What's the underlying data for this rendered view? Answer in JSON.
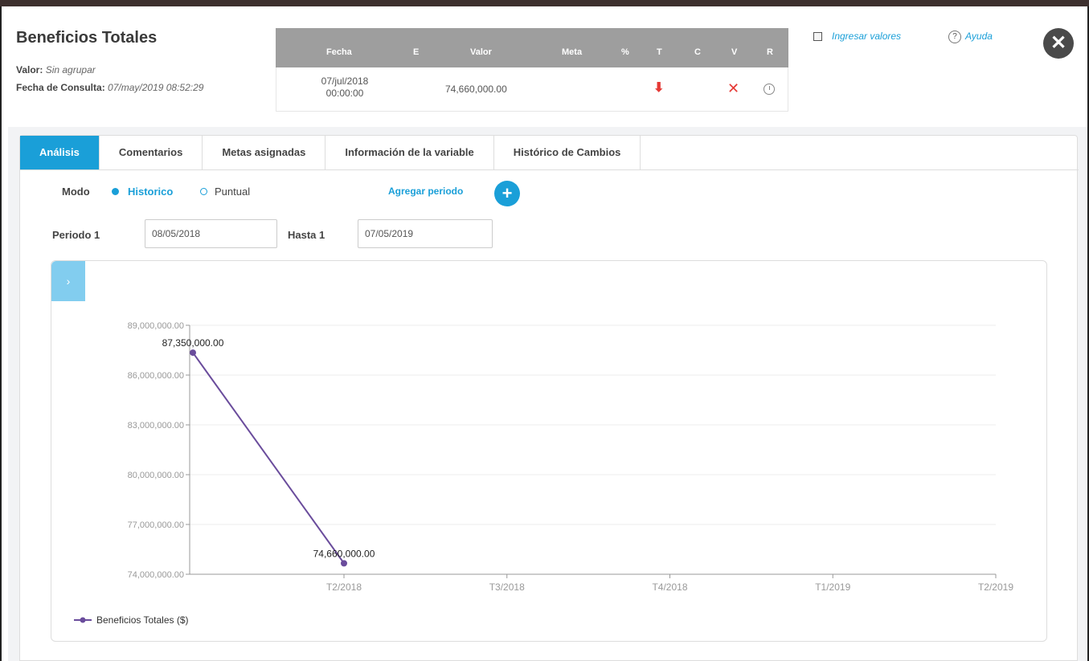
{
  "header": {
    "title": "Beneficios Totales",
    "valor_label": "Valor:",
    "valor_value": "Sin agrupar",
    "consulta_label": "Fecha de Consulta:",
    "consulta_value": "07/may/2019 08:52:29"
  },
  "value_table": {
    "columns": [
      "Fecha",
      "E",
      "Valor",
      "Meta",
      "%",
      "T",
      "C",
      "V",
      "R"
    ],
    "row": {
      "fecha": "07/jul/2018\n00:00:00",
      "valor": "74,660,000.00",
      "trend_icon": "arrow-down-icon",
      "v_icon": "x-icon",
      "r_icon": "clock-icon"
    }
  },
  "links": {
    "ingresar": "Ingresar valores",
    "ayuda": "Ayuda"
  },
  "close_symbol": "✕",
  "tabs": [
    "Análisis",
    "Comentarios",
    "Metas asignadas",
    "Información de la variable",
    "Histórico de Cambios"
  ],
  "mode": {
    "label": "Modo",
    "historico": "Historico",
    "puntual": "Puntual",
    "selected": "Historico"
  },
  "add_period_label": "Agregar periodo",
  "period": {
    "from_label": "Periodo 1",
    "from_value": "08/05/2018",
    "to_label": "Hasta 1",
    "to_value": "07/05/2019"
  },
  "toggle_symbol": "›",
  "colors": {
    "accent": "#1a9fd8",
    "series": "#6a4c9c",
    "danger": "#e53935"
  },
  "chart_data": {
    "type": "line",
    "x_ticks": [
      "T2/2018",
      "T3/2018",
      "T4/2018",
      "T1/2019",
      "T2/2019"
    ],
    "y_ticks": [
      "74,000,000.00",
      "77,000,000.00",
      "80,000,000.00",
      "83,000,000.00",
      "86,000,000.00",
      "89,000,000.00"
    ],
    "ylim": [
      74000000,
      89000000
    ],
    "series": [
      {
        "name": "Beneficios Totales ($)",
        "points": [
          {
            "x": "T1/2018",
            "y": 87350000,
            "label": "87,350,000.00"
          },
          {
            "x": "T2/2018",
            "y": 74660000,
            "label": "74,660,000.00"
          }
        ]
      }
    ],
    "legend": "bottom-left",
    "grid": true
  }
}
